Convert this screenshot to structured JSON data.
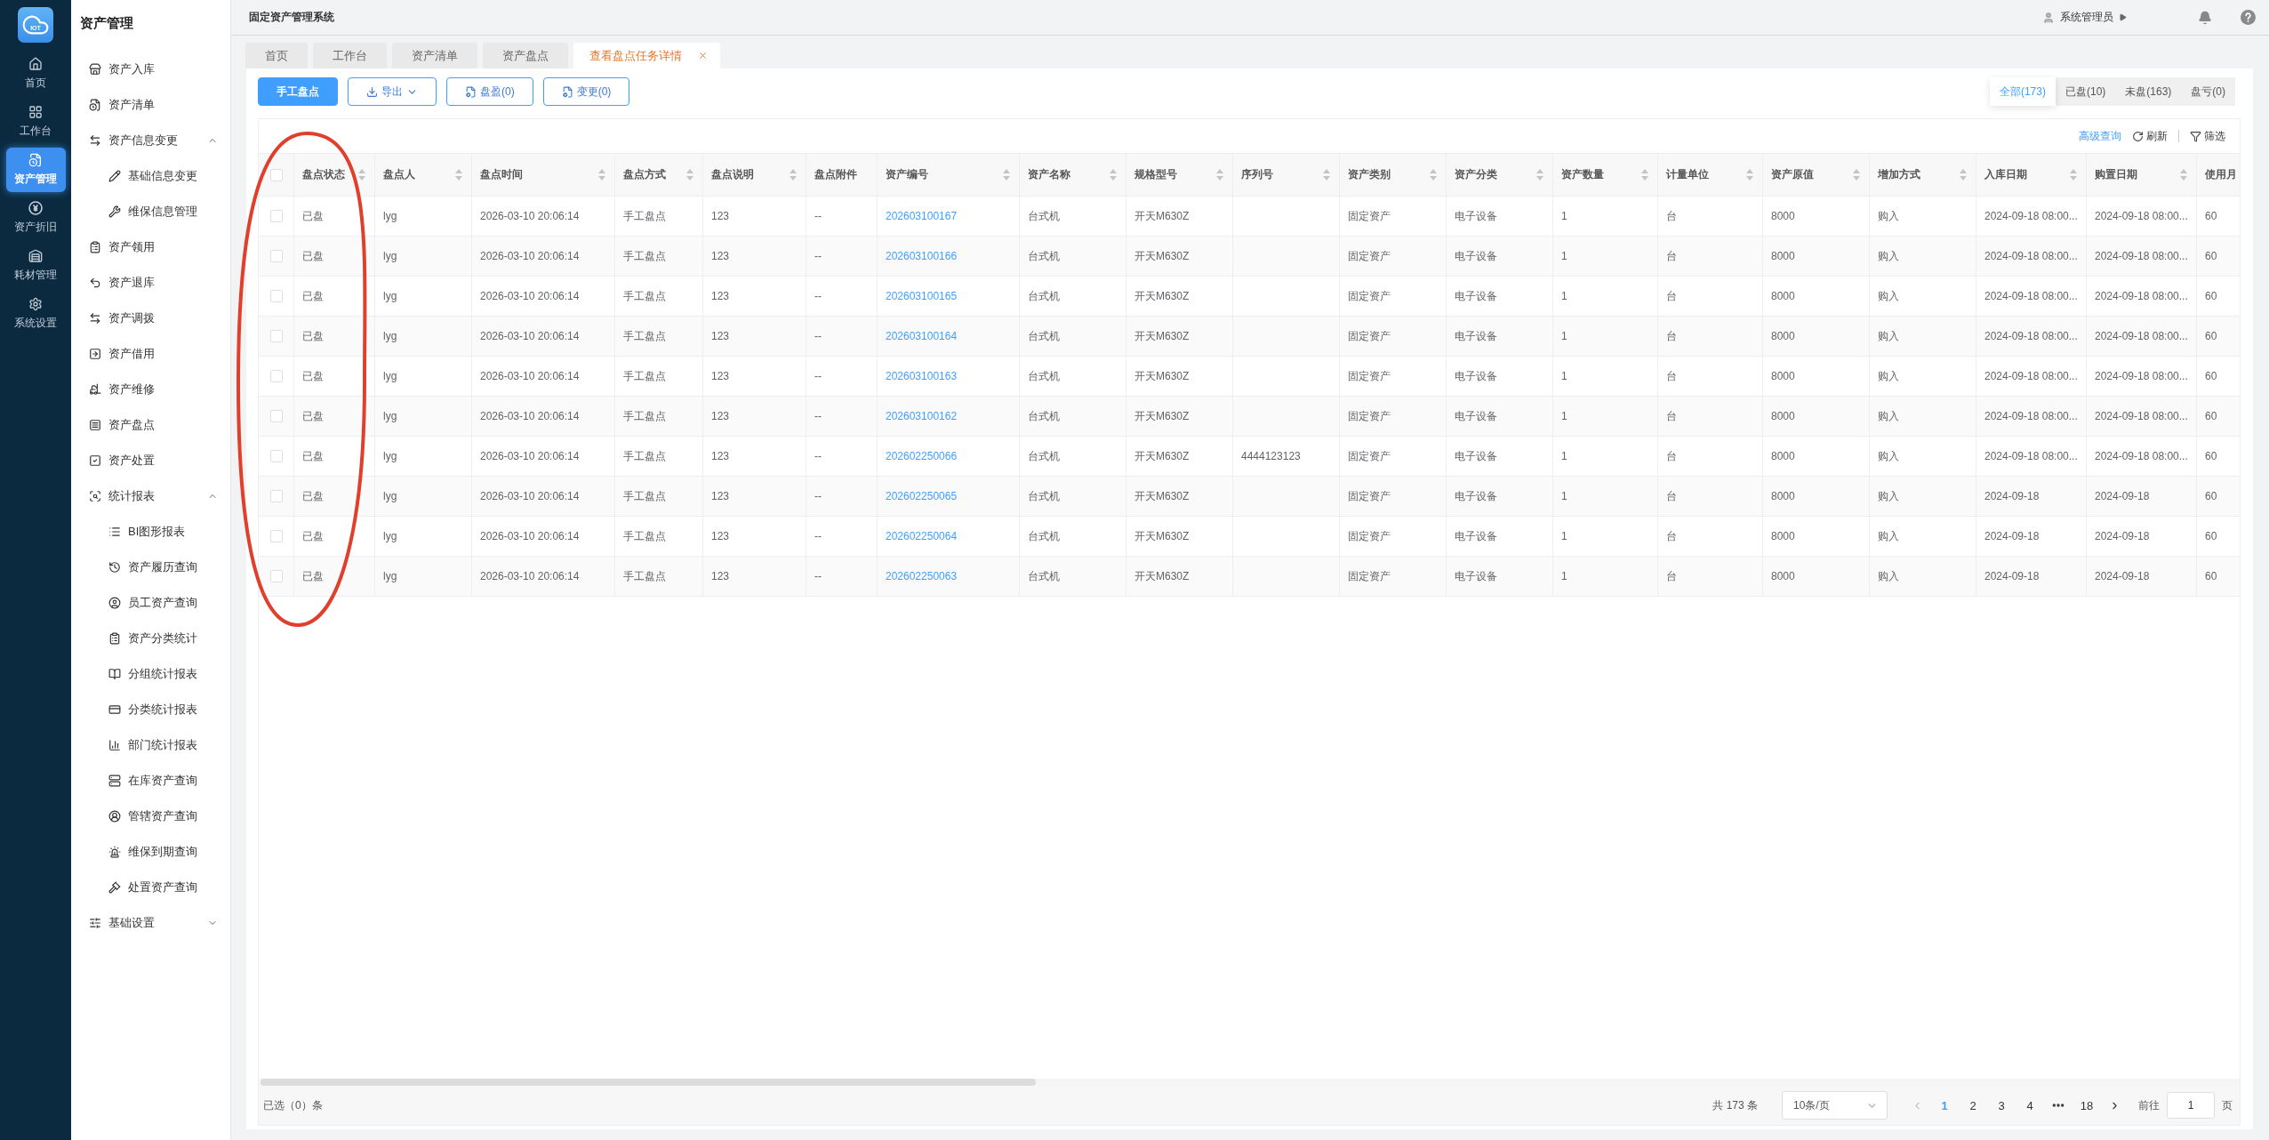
{
  "rail": {
    "logo_text": "IOT",
    "items": [
      {
        "label": "首页",
        "selected": false
      },
      {
        "label": "工作台",
        "selected": false
      },
      {
        "label": "资产管理",
        "selected": true
      },
      {
        "label": "资产折旧",
        "selected": false
      },
      {
        "label": "耗材管理",
        "selected": false
      },
      {
        "label": "系统设置",
        "selected": false
      }
    ]
  },
  "sidebar": {
    "title": "资产管理",
    "items": [
      {
        "label": "资产入库",
        "kind": "link"
      },
      {
        "label": "资产清单",
        "kind": "link"
      },
      {
        "label": "资产信息变更",
        "kind": "group",
        "expanded": true,
        "children": [
          {
            "label": "基础信息变更",
            "kind": "link"
          },
          {
            "label": "维保信息管理",
            "kind": "link"
          }
        ]
      },
      {
        "label": "资产领用",
        "kind": "link"
      },
      {
        "label": "资产退库",
        "kind": "link"
      },
      {
        "label": "资产调拨",
        "kind": "link"
      },
      {
        "label": "资产借用",
        "kind": "link"
      },
      {
        "label": "资产维修",
        "kind": "link"
      },
      {
        "label": "资产盘点",
        "kind": "link"
      },
      {
        "label": "资产处置",
        "kind": "link"
      },
      {
        "label": "统计报表",
        "kind": "group",
        "expanded": true,
        "children": [
          {
            "label": "BI图形报表",
            "kind": "link"
          },
          {
            "label": "资产履历查询",
            "kind": "link"
          },
          {
            "label": "员工资产查询",
            "kind": "link"
          },
          {
            "label": "资产分类统计",
            "kind": "link"
          },
          {
            "label": "分组统计报表",
            "kind": "link"
          },
          {
            "label": "分类统计报表",
            "kind": "link"
          },
          {
            "label": "部门统计报表",
            "kind": "link"
          },
          {
            "label": "在库资产查询",
            "kind": "link"
          },
          {
            "label": "管辖资产查询",
            "kind": "link"
          },
          {
            "label": "维保到期查询",
            "kind": "link"
          },
          {
            "label": "处置资产查询",
            "kind": "link"
          }
        ]
      },
      {
        "label": "基础设置",
        "kind": "group",
        "expanded": false
      }
    ]
  },
  "header": {
    "title": "固定资产管理系统",
    "user": "系统管理员"
  },
  "tabs": [
    {
      "label": "首页",
      "selected": false
    },
    {
      "label": "工作台",
      "selected": false
    },
    {
      "label": "资产清单",
      "selected": false
    },
    {
      "label": "资产盘点",
      "selected": false
    },
    {
      "label": "查看盘点任务详情",
      "selected": true
    }
  ],
  "toolbar": {
    "buttons": [
      {
        "label": "手工盘点",
        "kind": "primary"
      },
      {
        "label": "导出",
        "kind": "dropdown"
      },
      {
        "label": "盘盈(0)",
        "kind": "plain"
      },
      {
        "label": "变更(0)",
        "kind": "plain"
      }
    ],
    "status_tabs": [
      {
        "label": "全部(173)",
        "selected": true
      },
      {
        "label": "已盘(10)",
        "selected": false
      },
      {
        "label": "未盘(163)",
        "selected": false
      },
      {
        "label": "盘亏(0)",
        "selected": false
      }
    ]
  },
  "table": {
    "actions": [
      {
        "label": "高级查询",
        "kind": "link"
      },
      {
        "label": "刷新",
        "kind": "refresh"
      },
      {
        "label": "筛选",
        "kind": "filter"
      }
    ],
    "select_all": {
      "checked": false
    },
    "columns": [
      {
        "label": "盘点状态",
        "sortable": true,
        "kind": "text"
      },
      {
        "label": "盘点人",
        "sortable": true,
        "kind": "text"
      },
      {
        "label": "盘点时间",
        "sortable": true,
        "kind": "text"
      },
      {
        "label": "盘点方式",
        "sortable": true,
        "kind": "text"
      },
      {
        "label": "盘点说明",
        "sortable": true,
        "kind": "text"
      },
      {
        "label": "盘点附件",
        "sortable": false,
        "kind": "text"
      },
      {
        "label": "资产编号",
        "sortable": true,
        "kind": "link"
      },
      {
        "label": "资产名称",
        "sortable": true,
        "kind": "text"
      },
      {
        "label": "规格型号",
        "sortable": true,
        "kind": "text"
      },
      {
        "label": "序列号",
        "sortable": true,
        "kind": "text"
      },
      {
        "label": "资产类别",
        "sortable": true,
        "kind": "text"
      },
      {
        "label": "资产分类",
        "sortable": true,
        "kind": "text"
      },
      {
        "label": "资产数量",
        "sortable": true,
        "kind": "text"
      },
      {
        "label": "计量单位",
        "sortable": true,
        "kind": "text"
      },
      {
        "label": "资产原值",
        "sortable": true,
        "kind": "text"
      },
      {
        "label": "增加方式",
        "sortable": true,
        "kind": "text"
      },
      {
        "label": "入库日期",
        "sortable": true,
        "kind": "text"
      },
      {
        "label": "购置日期",
        "sortable": true,
        "kind": "text"
      },
      {
        "label": "使用月",
        "sortable": false,
        "kind": "text"
      }
    ],
    "rows": [
      {
        "checked": false,
        "cells": [
          "已盘",
          "lyg",
          "2026-03-10 20:06:14",
          "手工盘点",
          "123",
          "--",
          "202603100167",
          "台式机",
          "开天M630Z",
          null,
          "固定资产",
          "电子设备",
          "1",
          "台",
          "8000",
          "购入",
          "2024-09-18 08:00...",
          "2024-09-18 08:00...",
          "60"
        ]
      },
      {
        "checked": false,
        "cells": [
          "已盘",
          "lyg",
          "2026-03-10 20:06:14",
          "手工盘点",
          "123",
          "--",
          "202603100166",
          "台式机",
          "开天M630Z",
          null,
          "固定资产",
          "电子设备",
          "1",
          "台",
          "8000",
          "购入",
          "2024-09-18 08:00...",
          "2024-09-18 08:00...",
          "60"
        ]
      },
      {
        "checked": false,
        "cells": [
          "已盘",
          "lyg",
          "2026-03-10 20:06:14",
          "手工盘点",
          "123",
          "--",
          "202603100165",
          "台式机",
          "开天M630Z",
          null,
          "固定资产",
          "电子设备",
          "1",
          "台",
          "8000",
          "购入",
          "2024-09-18 08:00...",
          "2024-09-18 08:00...",
          "60"
        ]
      },
      {
        "checked": false,
        "cells": [
          "已盘",
          "lyg",
          "2026-03-10 20:06:14",
          "手工盘点",
          "123",
          "--",
          "202603100164",
          "台式机",
          "开天M630Z",
          null,
          "固定资产",
          "电子设备",
          "1",
          "台",
          "8000",
          "购入",
          "2024-09-18 08:00...",
          "2024-09-18 08:00...",
          "60"
        ]
      },
      {
        "checked": false,
        "cells": [
          "已盘",
          "lyg",
          "2026-03-10 20:06:14",
          "手工盘点",
          "123",
          "--",
          "202603100163",
          "台式机",
          "开天M630Z",
          null,
          "固定资产",
          "电子设备",
          "1",
          "台",
          "8000",
          "购入",
          "2024-09-18 08:00...",
          "2024-09-18 08:00...",
          "60"
        ]
      },
      {
        "checked": false,
        "cells": [
          "已盘",
          "lyg",
          "2026-03-10 20:06:14",
          "手工盘点",
          "123",
          "--",
          "202603100162",
          "台式机",
          "开天M630Z",
          null,
          "固定资产",
          "电子设备",
          "1",
          "台",
          "8000",
          "购入",
          "2024-09-18 08:00...",
          "2024-09-18 08:00...",
          "60"
        ]
      },
      {
        "checked": false,
        "cells": [
          "已盘",
          "lyg",
          "2026-03-10 20:06:14",
          "手工盘点",
          "123",
          "--",
          "202602250066",
          "台式机",
          "开天M630Z",
          "4444123123",
          "固定资产",
          "电子设备",
          "1",
          "台",
          "8000",
          "购入",
          "2024-09-18 08:00...",
          "2024-09-18 08:00...",
          "60"
        ]
      },
      {
        "checked": false,
        "cells": [
          "已盘",
          "lyg",
          "2026-03-10 20:06:14",
          "手工盘点",
          "123",
          "--",
          "202602250065",
          "台式机",
          "开天M630Z",
          null,
          "固定资产",
          "电子设备",
          "1",
          "台",
          "8000",
          "购入",
          "2024-09-18",
          "2024-09-18",
          "60"
        ]
      },
      {
        "checked": false,
        "cells": [
          "已盘",
          "lyg",
          "2026-03-10 20:06:14",
          "手工盘点",
          "123",
          "--",
          "202602250064",
          "台式机",
          "开天M630Z",
          null,
          "固定资产",
          "电子设备",
          "1",
          "台",
          "8000",
          "购入",
          "2024-09-18",
          "2024-09-18",
          "60"
        ]
      },
      {
        "checked": false,
        "cells": [
          "已盘",
          "lyg",
          "2026-03-10 20:06:14",
          "手工盘点",
          "123",
          "--",
          "202602250063",
          "台式机",
          "开天M630Z",
          null,
          "固定资产",
          "电子设备",
          "1",
          "台",
          "8000",
          "购入",
          "2024-09-18",
          "2024-09-18",
          "60"
        ]
      }
    ],
    "selected_count": "已选（0）条"
  },
  "pagination": {
    "total": "共 173 条",
    "page_size": "10条/页",
    "prev": {
      "disabled": true
    },
    "next": {
      "disabled": false
    },
    "pages": [
      {
        "kind": "page",
        "label": "1",
        "selected": true
      },
      {
        "kind": "page",
        "label": "2",
        "selected": false
      },
      {
        "kind": "page",
        "label": "3",
        "selected": false
      },
      {
        "kind": "page",
        "label": "4",
        "selected": false
      },
      {
        "kind": "more",
        "selected": false
      },
      {
        "kind": "page",
        "label": "18",
        "selected": false
      }
    ],
    "jump_label": "前往",
    "jump_value": "1",
    "jump_suffix": "页"
  }
}
